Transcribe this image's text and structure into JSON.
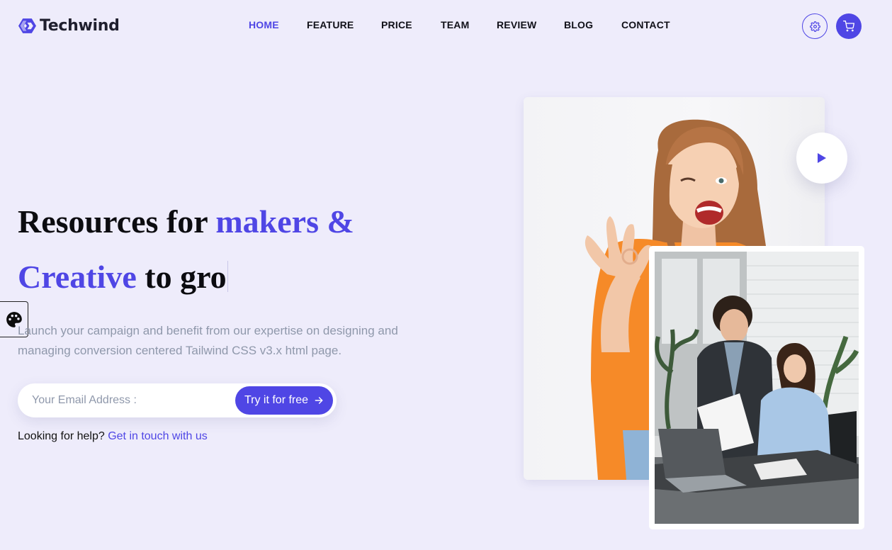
{
  "brand": {
    "name": "Techwind",
    "accent_color": "#4f46e5"
  },
  "nav": {
    "items": [
      {
        "label": "HOME",
        "active": true
      },
      {
        "label": "FEATURE"
      },
      {
        "label": "PRICE"
      },
      {
        "label": "TEAM"
      },
      {
        "label": "REVIEW"
      },
      {
        "label": "BLOG"
      },
      {
        "label": "CONTACT"
      }
    ]
  },
  "header": {
    "settings_icon": "gear-icon",
    "cart_icon": "cart-icon"
  },
  "hero": {
    "headline": {
      "part1": "Resources for ",
      "accent1": "makers &",
      "accent2": "Creative",
      "part2": " to gro"
    },
    "description": "Launch your campaign and benefit from our expertise on designing and managing conversion centered Tailwind CSS v3.x html page.",
    "email_placeholder": "Your Email Address :",
    "cta_label": "Try it for free",
    "help_text": "Looking for help? ",
    "help_link": "Get in touch with us"
  },
  "sidebar_widget": {
    "icon": "palette-icon"
  },
  "media": {
    "play_icon": "play-icon"
  }
}
